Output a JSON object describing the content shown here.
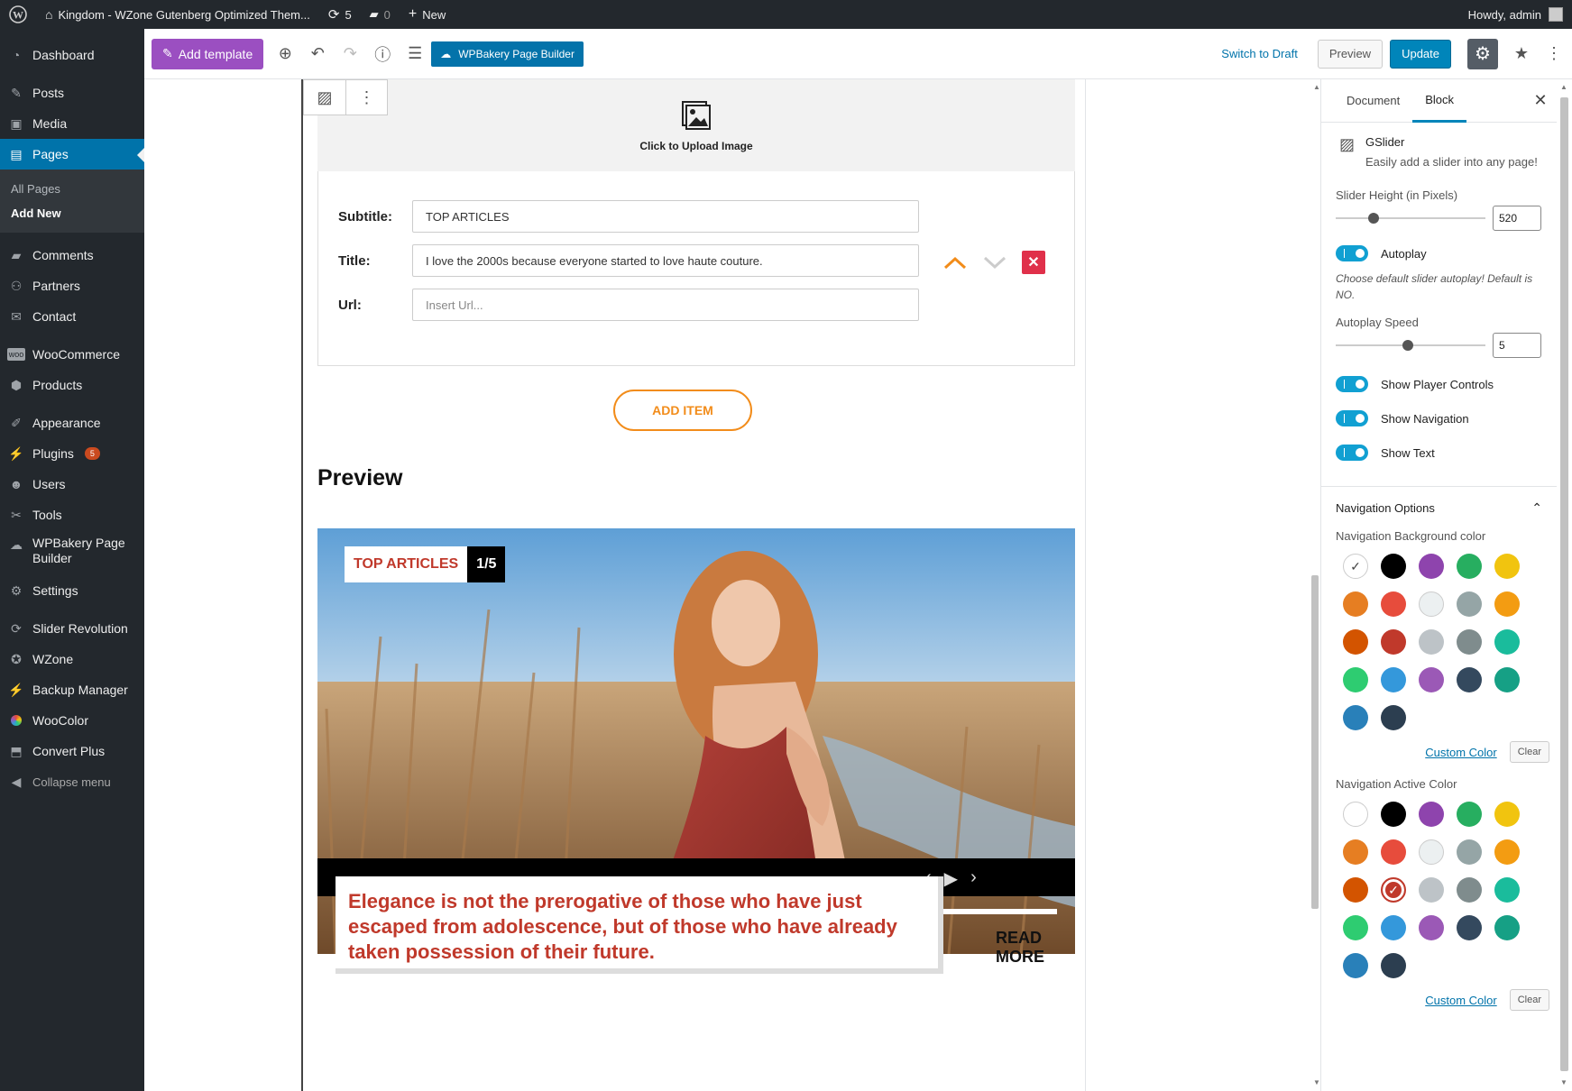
{
  "adminbar": {
    "site_title": "Kingdom - WZone Gutenberg Optimized Them...",
    "updates": "5",
    "comments": "0",
    "new": "New",
    "howdy": "Howdy, admin"
  },
  "menu": {
    "dashboard": "Dashboard",
    "posts": "Posts",
    "media": "Media",
    "pages": "Pages",
    "all_pages": "All Pages",
    "add_new": "Add New",
    "comments": "Comments",
    "partners": "Partners",
    "contact": "Contact",
    "woocommerce": "WooCommerce",
    "products": "Products",
    "appearance": "Appearance",
    "plugins": "Plugins",
    "plugins_badge": "5",
    "users": "Users",
    "tools": "Tools",
    "wpbakery": "WPBakery Page Builder",
    "settings": "Settings",
    "slider_revolution": "Slider Revolution",
    "wzone": "WZone",
    "backup_manager": "Backup Manager",
    "woocolor": "WooColor",
    "convert_plus": "Convert Plus",
    "collapse": "Collapse menu"
  },
  "toolbar": {
    "add_template": "Add template",
    "wpbakery": "WPBakery Page Builder",
    "switch_draft": "Switch to Draft",
    "preview": "Preview",
    "update": "Update"
  },
  "editor": {
    "upload_label": "Click to Upload Image",
    "subtitle_label": "Subtitle:",
    "subtitle_value": "TOP ARTICLES",
    "title_label": "Title:",
    "title_value": "I love the 2000s because everyone started to love haute couture.",
    "url_label": "Url:",
    "url_placeholder": "Insert Url...",
    "add_item": "ADD ITEM",
    "preview_heading": "Preview"
  },
  "slide": {
    "tag": "TOP ARTICLES",
    "counter": "1/5",
    "progress_segments": 5,
    "caption": "Elegance is not the prerogative of those who have just escaped from adolescence, but of those who have already taken possession of their future.",
    "read_more": "READ MORE"
  },
  "sidebar": {
    "tab_document": "Document",
    "tab_block": "Block",
    "block_name": "GSlider",
    "block_desc": "Easily add a slider into any page!",
    "slider_height_label": "Slider Height (in Pixels)",
    "slider_height_value": "520",
    "autoplay_label": "Autoplay",
    "autoplay_help": "Choose default slider autoplay! Default is NO.",
    "autoplay_speed_label": "Autoplay Speed",
    "autoplay_speed_value": "5",
    "show_player_controls": "Show Player Controls",
    "show_navigation": "Show Navigation",
    "show_text": "Show Text",
    "nav_options": "Navigation Options",
    "nav_bg_label": "Navigation Background color",
    "nav_active_label": "Navigation Active Color",
    "custom_color": "Custom Color",
    "clear": "Clear",
    "palette": [
      "#ffffff",
      "#000000",
      "#8e44ad",
      "#27ae60",
      "#f1c40f",
      "#e67e22",
      "#e74c3c",
      "#ecf0f1",
      "#95a5a6",
      "#f39c12",
      "#d35400",
      "#c0392b",
      "#bdc3c7",
      "#7f8c8d",
      "#1abc9c",
      "#2ecc71",
      "#3498db",
      "#9b59b6",
      "#34495e",
      "#16a085",
      "#2980b9",
      "#2c3e50"
    ]
  }
}
